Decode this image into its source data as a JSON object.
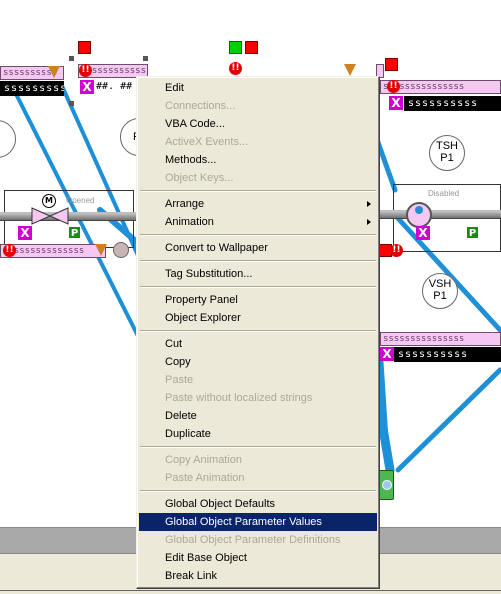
{
  "canvas": {
    "tag_mask": "ssssssssss",
    "tag_mask_long": "sssssssssssssss",
    "hash_value": "##. ##",
    "valve_state": "Opened",
    "pump_state": "Disabled",
    "tsh_line1": "TSH",
    "tsh_line2": "P1",
    "vsh_line1": "VSH",
    "vsh_line2": "P1",
    "circle_left_label": "P",
    "motor_label": "M",
    "p_badge": "P",
    "x_badge": "X",
    "alarm_badge": "!!",
    "colors": {
      "pink": "#f4c8f0",
      "pipe_blue": "#1e90d8",
      "alarm_red": "#ff0000",
      "ok_green": "#00d000",
      "selection": "#0a246a"
    }
  },
  "menu": {
    "items": [
      {
        "label": "Edit",
        "enabled": true
      },
      {
        "label": "Connections...",
        "enabled": false
      },
      {
        "label": "VBA Code...",
        "enabled": true
      },
      {
        "label": "ActiveX Events...",
        "enabled": false
      },
      {
        "label": "Methods...",
        "enabled": true
      },
      {
        "label": "Object Keys...",
        "enabled": false
      },
      {
        "sep": true
      },
      {
        "label": "Arrange",
        "enabled": true,
        "submenu": true
      },
      {
        "label": "Animation",
        "enabled": true,
        "submenu": true
      },
      {
        "sep": true
      },
      {
        "label": "Convert to Wallpaper",
        "enabled": true
      },
      {
        "sep": true
      },
      {
        "label": "Tag Substitution...",
        "enabled": true
      },
      {
        "sep": true
      },
      {
        "label": "Property Panel",
        "enabled": true
      },
      {
        "label": "Object Explorer",
        "enabled": true
      },
      {
        "sep": true
      },
      {
        "label": "Cut",
        "enabled": true
      },
      {
        "label": "Copy",
        "enabled": true
      },
      {
        "label": "Paste",
        "enabled": false
      },
      {
        "label": "Paste without localized strings",
        "enabled": false
      },
      {
        "label": "Delete",
        "enabled": true
      },
      {
        "label": "Duplicate",
        "enabled": true
      },
      {
        "sep": true
      },
      {
        "label": "Copy Animation",
        "enabled": false
      },
      {
        "label": "Paste Animation",
        "enabled": false
      },
      {
        "sep": true
      },
      {
        "label": "Global Object Defaults",
        "enabled": true
      },
      {
        "label": "Global Object Parameter Values",
        "enabled": true,
        "highlighted": true
      },
      {
        "label": "Global Object Parameter Definitions",
        "enabled": false
      },
      {
        "label": "Edit Base Object",
        "enabled": true
      },
      {
        "label": "Break Link",
        "enabled": true
      }
    ]
  }
}
